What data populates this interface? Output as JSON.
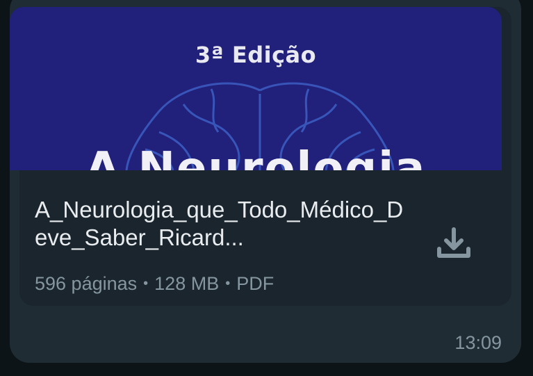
{
  "message": {
    "document": {
      "preview": {
        "edition_text": "3ª Edição",
        "title_fragment": "A Neurologia"
      },
      "file_name": "A_Neurologia_que_Todo_Médico_Deve_Saber_Ricard...",
      "pages": "596 páginas",
      "size": "128 MB",
      "type": "PDF",
      "separator": "•",
      "download_icon": "download-icon"
    },
    "time": "13:09"
  },
  "colors": {
    "bubble": "#1f2c34",
    "card": "#1a252d",
    "cover": "#21207a",
    "text_primary": "#e9edef",
    "text_secondary": "#8696a0"
  }
}
